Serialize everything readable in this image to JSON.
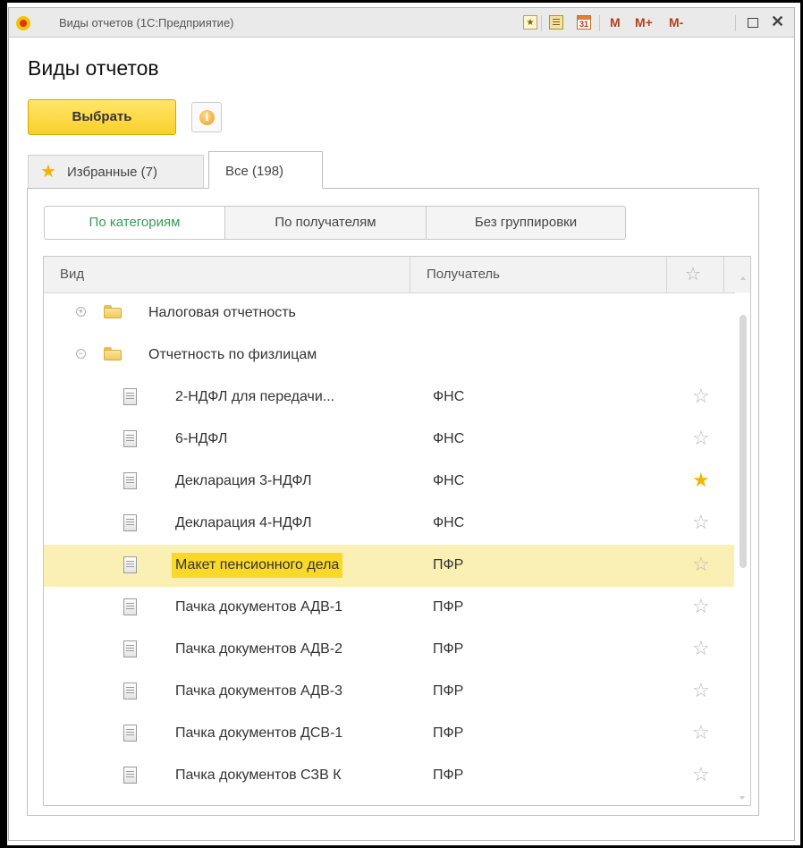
{
  "window": {
    "title": "Виды отчетов  (1С:Предприятие)",
    "toolbar": {
      "cal_day": "31",
      "m_label": "M",
      "mplus_label": "M+",
      "mminus_label": "M-",
      "close_glyph": "✕"
    }
  },
  "page": {
    "title": "Виды отчетов",
    "select_button": "Выбрать",
    "info_glyph": "i"
  },
  "tabs": [
    {
      "label": "Избранные (7)",
      "active": false
    },
    {
      "label": "Все (198)",
      "active": true
    }
  ],
  "grouping": [
    {
      "label": "По категориям",
      "active": true
    },
    {
      "label": "По получателям",
      "active": false
    },
    {
      "label": "Без группировки",
      "active": false
    }
  ],
  "grid": {
    "columns": {
      "vid": "Вид",
      "recipient": "Получатель",
      "star": "☆"
    },
    "groups": [
      {
        "label": "Налоговая отчетность",
        "expander": "+",
        "expanded": false
      },
      {
        "label": "Отчетность по физлицам",
        "expander": "−",
        "expanded": true
      }
    ],
    "rows": [
      {
        "name": "2-НДФЛ для передачи...",
        "recipient": "ФНС",
        "favorite": false,
        "selected": false
      },
      {
        "name": "6-НДФЛ",
        "recipient": "ФНС",
        "favorite": false,
        "selected": false
      },
      {
        "name": "Декларация 3-НДФЛ",
        "recipient": "ФНС",
        "favorite": true,
        "selected": false
      },
      {
        "name": "Декларация 4-НДФЛ",
        "recipient": "ФНС",
        "favorite": false,
        "selected": false
      },
      {
        "name": "Макет пенсионного дела",
        "recipient": "ПФР",
        "favorite": false,
        "selected": true
      },
      {
        "name": "Пачка документов АДВ-1",
        "recipient": "ПФР",
        "favorite": false,
        "selected": false
      },
      {
        "name": "Пачка документов АДВ-2",
        "recipient": "ПФР",
        "favorite": false,
        "selected": false
      },
      {
        "name": "Пачка документов АДВ-3",
        "recipient": "ПФР",
        "favorite": false,
        "selected": false
      },
      {
        "name": "Пачка документов ДСВ-1",
        "recipient": "ПФР",
        "favorite": false,
        "selected": false
      },
      {
        "name": "Пачка документов СЗВ К",
        "recipient": "ПФР",
        "favorite": false,
        "selected": false
      }
    ],
    "star_on": "★",
    "star_off": "☆"
  },
  "colors": {
    "accent_yellow": "#f9cf2a",
    "selected_row": "#fbf0b4",
    "active_group_text": "#3c9a58",
    "favorite_star": "#f2b800"
  }
}
